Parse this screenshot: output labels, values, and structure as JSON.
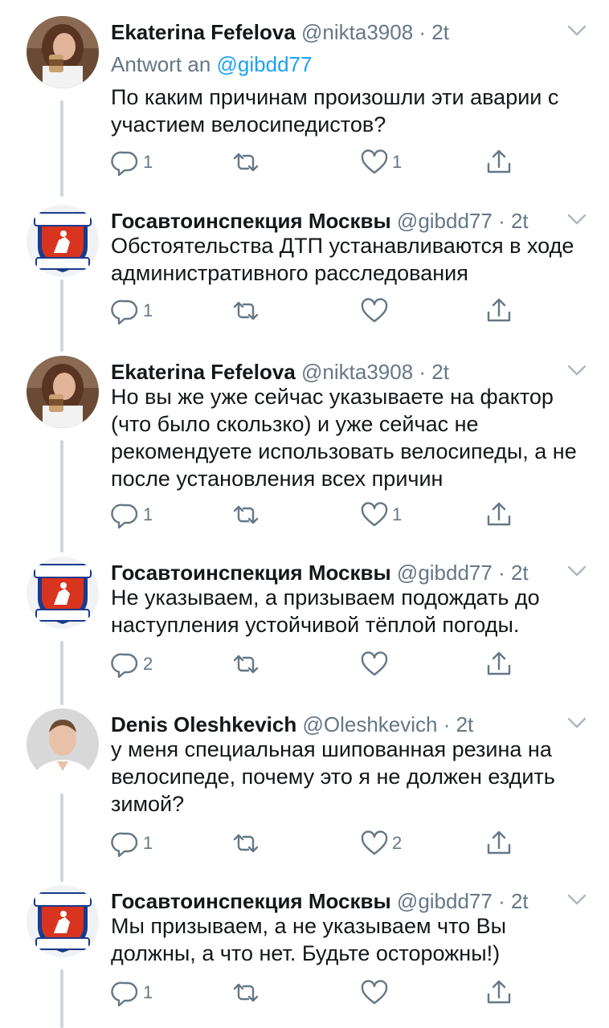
{
  "tweets": [
    {
      "name": "Ekaterina Fefelova",
      "handle": "@nikta3908",
      "time": "2t",
      "reply_to_prefix": "Antwort an ",
      "reply_to_link": "@gibdd77",
      "text": "По каким причинам произошли эти аварии с участием велосипедистов?",
      "avatar": "avatar-woman",
      "reply_count": "1",
      "retweet_count": "",
      "like_count": "1"
    },
    {
      "name": "Госавтоинспекция Москвы",
      "handle": "@gibdd77",
      "time": "2t",
      "text": "Обстоятельства ДТП устанавливаются в ходе административного расследования",
      "avatar": "avatar-gibdd-logo",
      "reply_count": "1",
      "retweet_count": "",
      "like_count": ""
    },
    {
      "name": "Ekaterina Fefelova",
      "handle": "@nikta3908",
      "time": "2t",
      "text": "Но вы же уже сейчас указываете на фактор (что было скользко) и уже сейчас не рекомендуете использовать велосипеды, а не после установления всех причин",
      "avatar": "avatar-woman",
      "reply_count": "1",
      "retweet_count": "",
      "like_count": "1"
    },
    {
      "name": "Госавтоинспекция Москвы",
      "handle": "@gibdd77",
      "time": "2t",
      "text": "Не указываем, а призываем подождать до наступления устойчивой тёплой погоды.",
      "avatar": "avatar-gibdd-logo",
      "reply_count": "2",
      "retweet_count": "",
      "like_count": ""
    },
    {
      "name": "Denis Oleshkevich",
      "handle": "@Oleshkevich",
      "time": "2t",
      "text": "у меня специальная шипованная резина на велосипеде, почему это я не должен ездить зимой?",
      "avatar": "avatar-man",
      "reply_count": "1",
      "retweet_count": "",
      "like_count": "2"
    },
    {
      "name": "Госавтоинспекция Москвы",
      "handle": "@gibdd77",
      "time": "2t",
      "text": "Мы призываем, а не указываем что Вы должны, а что нет. Будьте осторожны!)",
      "avatar": "avatar-gibdd-logo",
      "reply_count": "1",
      "retweet_count": "",
      "like_count": ""
    }
  ],
  "logo_text": {
    "top": "ГИБДД",
    "bottom": "МОСКВА"
  },
  "icons": [
    "reply-icon",
    "retweet-icon",
    "like-icon",
    "share-icon",
    "chevron-down-icon"
  ],
  "colors": {
    "text": "#14171a",
    "secondary": "#657786",
    "link": "#1da1f2",
    "thread_line": "#ccd6dd",
    "logo_red": "#d9341f",
    "logo_blue": "#1a3a8c"
  }
}
